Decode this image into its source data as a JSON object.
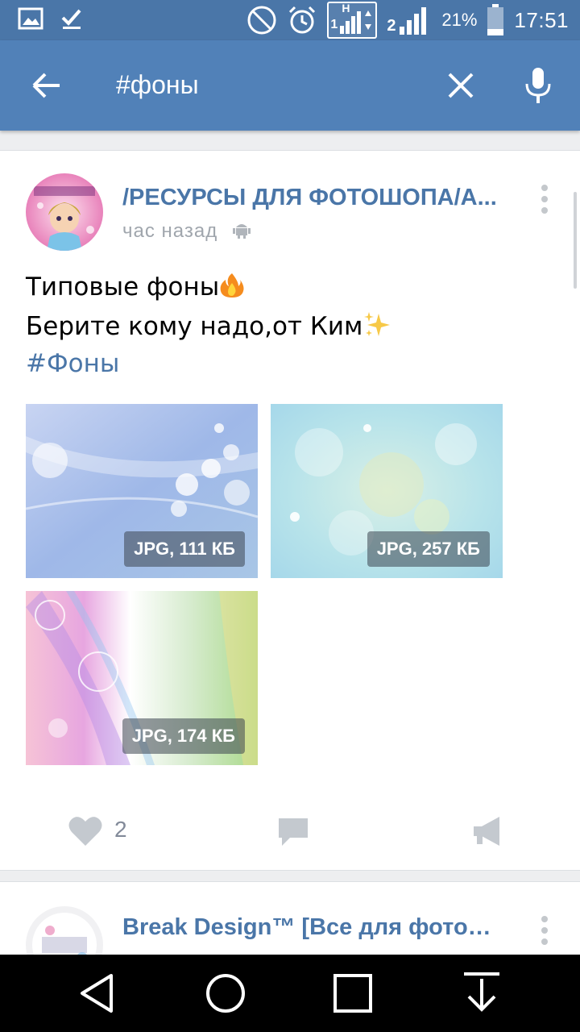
{
  "status_bar": {
    "battery": "21%",
    "time": "17:51",
    "sim1_label": "1",
    "sim1_network": "H",
    "sim2_label": "2"
  },
  "toolbar": {
    "search_query": "#фоны"
  },
  "post": {
    "group_name": "/РЕСУРСЫ ДЛЯ ФОТОШОПА/А...",
    "time": "час назад",
    "text_line1": "Типовые фоны",
    "text_line2": "Берите кому надо,от Ким",
    "hashtag": "#Фоны",
    "attachments": [
      {
        "label": "JPG, 111 КБ"
      },
      {
        "label": "JPG, 257 КБ"
      },
      {
        "label": "JPG, 174 КБ"
      }
    ],
    "likes": "2"
  },
  "next_post": {
    "group_name": "Break Design™ [Все для фотош..."
  },
  "colors": {
    "brand": "#5181b8",
    "status_bar": "#4a76a8",
    "link": "#4a76a8",
    "muted": "#828a99"
  }
}
